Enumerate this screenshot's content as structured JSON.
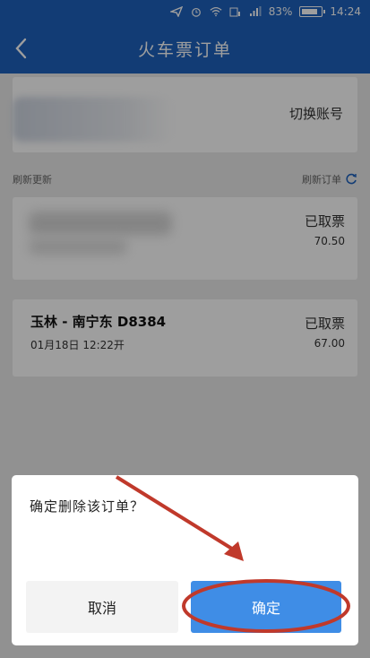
{
  "status_bar": {
    "battery": "83%",
    "time": "14:24"
  },
  "app_bar": {
    "title": "火车票订单"
  },
  "account": {
    "switch_label": "切换账号"
  },
  "refresh_row": {
    "left_label": "刷新更新",
    "right_label": "刷新订单"
  },
  "orders": [
    {
      "status": "已取票",
      "price": "70.50"
    },
    {
      "route": "玉林 - 南宁东  D8384",
      "date": "01月18日  12:22开",
      "status": "已取票",
      "price": "67.00"
    }
  ],
  "dialog": {
    "message": "确定删除该订单？",
    "cancel_label": "取消",
    "confirm_label": "确定"
  },
  "colors": {
    "primary": "#1e62bd",
    "confirm": "#3f8de6",
    "annotation": "#c0392b"
  }
}
